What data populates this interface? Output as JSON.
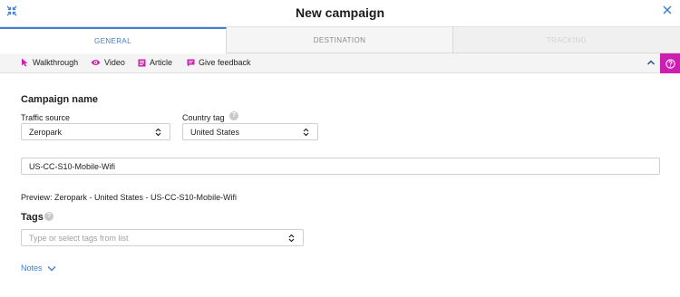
{
  "header": {
    "title": "New campaign"
  },
  "tabs": [
    {
      "label": "GENERAL"
    },
    {
      "label": "DESTINATION"
    },
    {
      "label": "TRACKING"
    }
  ],
  "help_bar": {
    "walkthrough": "Walkthrough",
    "video": "Video",
    "article": "Article",
    "feedback": "Give feedback"
  },
  "form": {
    "section_title": "Campaign name",
    "traffic_source": {
      "label": "Traffic source",
      "value": "Zeropark"
    },
    "country_tag": {
      "label": "Country tag",
      "value": "United States"
    },
    "campaign_name_value": "US-CC-S10-Mobile-Wifi",
    "preview": "Preview: Zeropark - United States - US-CC-S10-Mobile-Wifi",
    "tags": {
      "title": "Tags",
      "placeholder": "Type or select tags from list"
    },
    "notes_label": "Notes"
  },
  "colors": {
    "accent": "#3f7fd4",
    "help_magenta": "#cc1fb2",
    "help_bar_bg": "#f4f4f4"
  },
  "icons": [
    "compress-icon",
    "close-icon",
    "cursor-icon",
    "eye-icon",
    "article-icon",
    "feedback-icon",
    "chevron-up-icon",
    "help-icon",
    "info-icon",
    "select-arrows-icon",
    "chevron-down-icon"
  ]
}
